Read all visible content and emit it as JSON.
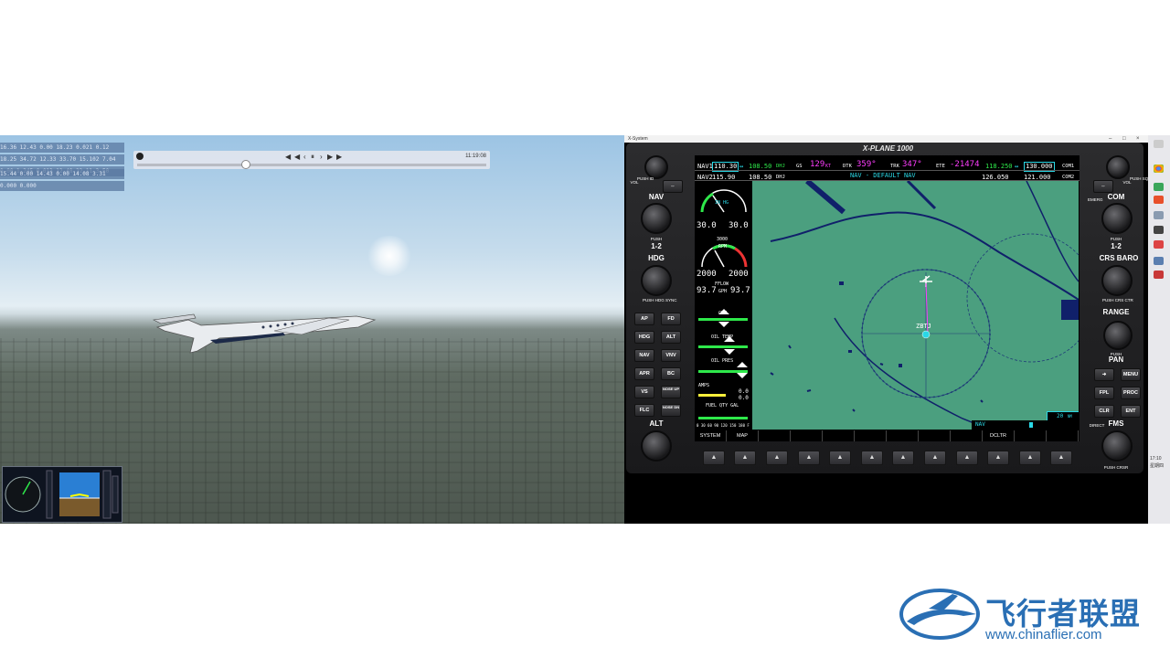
{
  "sim_view": {
    "debug_rows": [
      "16.36 12.43  0.00  18.23  0.021  0.12",
      "18.25 34.72 12.33  33.70 15.102  7.04",
      "0.00  1.245 0.013 12.48  22.11  3.50",
      "15.44  0.00 14.43  0.00  14.08  3.31",
      "0.000  0.000"
    ],
    "replay": {
      "controls": [
        "◀",
        "◀",
        "‹",
        "⏸",
        "›",
        "▶",
        "▶"
      ],
      "time": "11:19:08",
      "position_fraction": 0.31
    }
  },
  "g1000": {
    "window_title": "X-System",
    "title": "X-PLANE 1000",
    "nav1": {
      "label": "NAV1",
      "active": "110.30",
      "arrow": "↔",
      "standby": "108.50",
      "id": "DHJ"
    },
    "nav2": {
      "label": "NAV2",
      "active": "115.90",
      "standby": "108.50",
      "id": "DHJ"
    },
    "gs": {
      "label": "GS",
      "value": "129",
      "unit": "KT"
    },
    "dtk": {
      "label": "DTK",
      "value": "359°"
    },
    "trk": {
      "label": "TRK",
      "value": "347°"
    },
    "ete": {
      "label": "ETE",
      "value": "-21474"
    },
    "nav_mode": "NAV - DEFAULT NAV",
    "com1": {
      "label": "COM1",
      "active": "118.250",
      "arrow": "↔",
      "standby": "130.000"
    },
    "com2": {
      "label": "COM2",
      "active": "126.050",
      "standby": "121.000"
    },
    "eis": {
      "map_label": "IN HG",
      "map_l": "30.0",
      "map_r": "30.0",
      "rpm_label": "RPM",
      "rpm_top": "3000",
      "rpm_l": "2000",
      "rpm_r": "2000",
      "fflow_label": "FFLOW",
      "gph_label": "GPH",
      "ff_l": "93.7",
      "ff_r": "93.7",
      "cht_label": "CHT",
      "oil_temp_label": "OIL TEMP",
      "oil_pres_label": "OIL PRES",
      "amps_label": "AMPS",
      "amps_top": "0.0",
      "amps_bot": "0.0",
      "fuel_label": "FUEL QTY GAL",
      "fuel_scale": "0 30 60 90 120 150 180 F"
    },
    "map": {
      "waypoint": "ZBTJ",
      "range": "20",
      "range_unit": "NM",
      "nav_indicator": "NAV"
    },
    "softkey_labels": [
      "SYSTEM",
      "MAP",
      "",
      "",
      "",
      "",
      "",
      "",
      "",
      "DCLTR",
      "",
      ""
    ],
    "left_panel": {
      "vol_label": "VOL",
      "push_id": "PUSH ID",
      "nav_label": "NAV",
      "push_12": "PUSH",
      "nav_12": "1-2",
      "hdg_label": "HDG",
      "push_hdg_sync": "PUSH HDG SYNC",
      "keys": [
        [
          "AP",
          "FD"
        ],
        [
          "HDG",
          "ALT"
        ],
        [
          "NAV",
          "VNV"
        ],
        [
          "APR",
          "BC"
        ],
        [
          "VS",
          "NOSE UP"
        ],
        [
          "FLC",
          "NOSE DN"
        ]
      ],
      "alt_label": "ALT"
    },
    "right_panel": {
      "vol_label": "VOL",
      "push_sq": "PUSH SQ",
      "emerg": "EMERG",
      "com_label": "COM",
      "push_12": "PUSH",
      "com_12": "1-2",
      "crs_baro": "CRS BARO",
      "push_crs_ctr": "PUSH CRS CTR",
      "range_label": "RANGE",
      "push_pan": "PUSH",
      "pan_label": "PAN",
      "keys": [
        [
          "➜",
          "MENU"
        ],
        [
          "FPL",
          "PROC"
        ],
        [
          "CLR",
          "ENT"
        ]
      ],
      "direct": "DIRECT",
      "fms_label": "FMS",
      "push_crsr": "PUSH CRSR"
    }
  },
  "taskbar": {
    "clock": "17:10",
    "date": "星期四"
  },
  "watermark": {
    "name": "飞行者联盟",
    "url": "www.chinaflier.com"
  }
}
